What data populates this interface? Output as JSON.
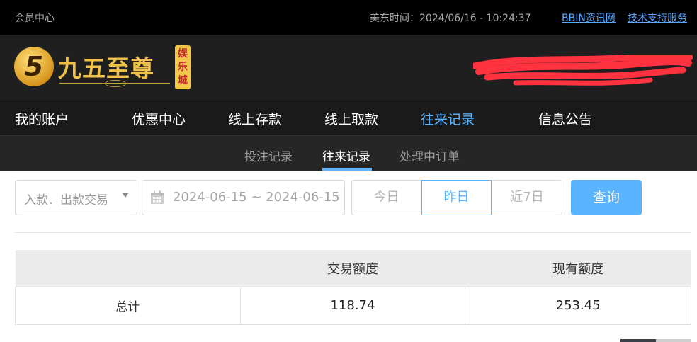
{
  "topbar": {
    "member_center": "会员中心",
    "time_label": "美东时间：2024/06/16 - 10:24:37",
    "link_bbin": "BBIN资讯网",
    "link_support": "技术支持服务"
  },
  "logo": {
    "number": "5",
    "name": "九五至尊",
    "badge": "娱乐城"
  },
  "nav": {
    "items": [
      "我的账户",
      "优惠中心",
      "线上存款",
      "线上取款",
      "往来记录",
      "信息公告"
    ],
    "active": "往来记录"
  },
  "subnav": {
    "items": [
      "投注记录",
      "往来记录",
      "处理中订单"
    ],
    "active": "往来记录"
  },
  "filters": {
    "type_value": "入款．出款交易",
    "date_range": "2024-06-15 ~ 2024-06-15",
    "quick": [
      "今日",
      "昨日",
      "近7日"
    ],
    "quick_active": "昨日",
    "query_label": "查询"
  },
  "summary_table": {
    "headers": [
      "",
      "交易额度",
      "现有额度"
    ],
    "row": {
      "label": "总计",
      "amount": "118.74",
      "balance": "253.45"
    }
  },
  "colors": {
    "accent": "#5ab4ff",
    "topbar_bg": "#000000",
    "header_bg": "#1f1f1f",
    "logo_gold": "#f1c24a"
  }
}
